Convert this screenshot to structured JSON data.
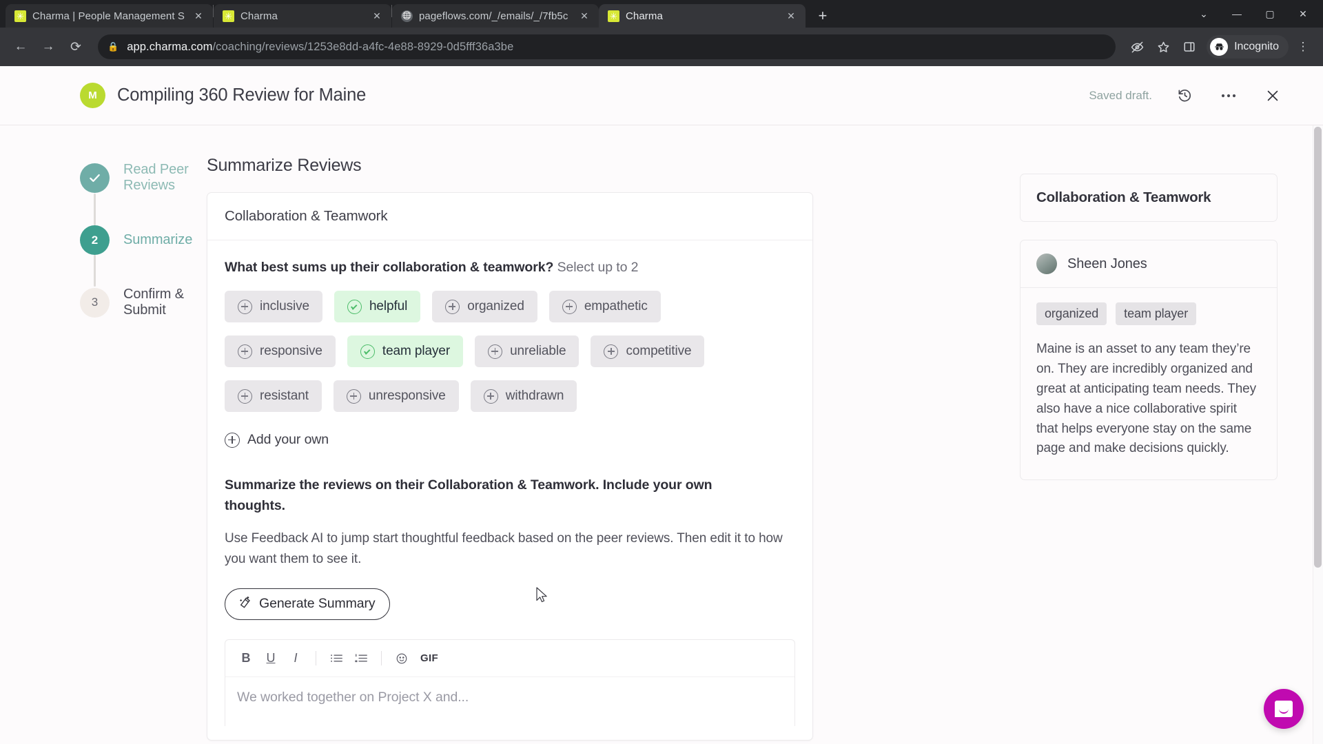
{
  "browser": {
    "tabs": [
      {
        "title": "Charma | People Management S",
        "favicon": "charma-star-icon",
        "active": false
      },
      {
        "title": "Charma",
        "favicon": "charma-star-icon",
        "active": false
      },
      {
        "title": "pageflows.com/_/emails/_/7fb5c",
        "favicon": "globe-icon",
        "active": false
      },
      {
        "title": "Charma",
        "favicon": "charma-star-icon",
        "active": true
      }
    ],
    "new_tab_label": "+",
    "close_label": "✕",
    "window_controls": {
      "minimize": "—",
      "maximize": "▢",
      "close": "✕",
      "tab_search": "⌄"
    },
    "nav": {
      "back": "←",
      "forward": "→",
      "reload": "⟳"
    },
    "omnibox": {
      "lock_icon": "lock-icon",
      "host": "app.charma.com",
      "path": "/coaching/reviews/1253e8dd-a4fc-4e88-8929-0d5fff36a3be"
    },
    "toolbar_icons": [
      "eye-off-icon",
      "star-icon",
      "side-panel-icon",
      "kebab-menu-icon"
    ],
    "profile": {
      "label": "Incognito",
      "icon": "incognito-icon"
    }
  },
  "header": {
    "avatar_initial": "M",
    "title": "Compiling 360 Review for Maine",
    "saved_status": "Saved draft.",
    "history_icon": "history-revert-icon",
    "more_icon": "more-horizontal-icon",
    "close_icon": "close-icon"
  },
  "stepper": {
    "steps": [
      {
        "marker": "✓",
        "label": "Read Peer Reviews",
        "state": "done"
      },
      {
        "marker": "2",
        "label": "Summarize",
        "state": "current"
      },
      {
        "marker": "3",
        "label": "Confirm & Submit",
        "state": "todo"
      }
    ]
  },
  "main": {
    "section_title": "Summarize Reviews",
    "card_title": "Collaboration & Teamwork",
    "question": "What best sums up their collaboration & teamwork?",
    "question_hint": "Select up to 2",
    "chip_rows": [
      [
        {
          "label": "inclusive",
          "selected": false
        },
        {
          "label": "helpful",
          "selected": true
        },
        {
          "label": "organized",
          "selected": false
        },
        {
          "label": "empathetic",
          "selected": false
        }
      ],
      [
        {
          "label": "responsive",
          "selected": false
        },
        {
          "label": "team player",
          "selected": true
        },
        {
          "label": "unreliable",
          "selected": false
        },
        {
          "label": "competitive",
          "selected": false
        }
      ],
      [
        {
          "label": "resistant",
          "selected": false
        },
        {
          "label": "unresponsive",
          "selected": false
        },
        {
          "label": "withdrawn",
          "selected": false
        }
      ]
    ],
    "add_own_label": "Add your own",
    "prompt_strong": "Summarize the reviews on their Collaboration & Teamwork. Include your own thoughts.",
    "prompt_sub": "Use Feedback AI to jump start thoughtful feedback based on the peer reviews. Then edit it to how you want them to see it.",
    "generate_button": "Generate Summary",
    "generate_icon": "magic-wand-icon",
    "editor": {
      "tools": [
        {
          "name": "bold",
          "glyph": "B"
        },
        {
          "name": "underline",
          "glyph": "U"
        },
        {
          "name": "italic",
          "glyph": "I"
        },
        {
          "name": "bulleted-list",
          "glyph": "☰"
        },
        {
          "name": "numbered-list",
          "glyph": "≣"
        },
        {
          "name": "emoji",
          "glyph": "☺"
        },
        {
          "name": "gif",
          "glyph": "GIF"
        }
      ],
      "placeholder": "We worked together on Project X and..."
    }
  },
  "right_panel": {
    "title": "Collaboration & Teamwork",
    "review": {
      "reviewer": "Sheen Jones",
      "tags": [
        "organized",
        "team player"
      ],
      "body": "Maine is an asset to any team they’re on. They are incredibly organized and great at anticipating team needs. They also have a nice collaborative spirit that helps everyone stay on the same page and make decisions quickly."
    }
  },
  "overlays": {
    "intercom_label": "intercom-chat-launcher"
  },
  "colors": {
    "brand_lime": "#bada30",
    "step_done": "#6fada7",
    "step_current": "#3e9f8f",
    "step_todo": "#f2ece8",
    "chip_default": "#e9e7ea",
    "chip_selected": "#ddf7e0",
    "chip_check": "#4dbd6a",
    "page_bg": "#fdfbfc",
    "intercom": "#c00ab0"
  }
}
